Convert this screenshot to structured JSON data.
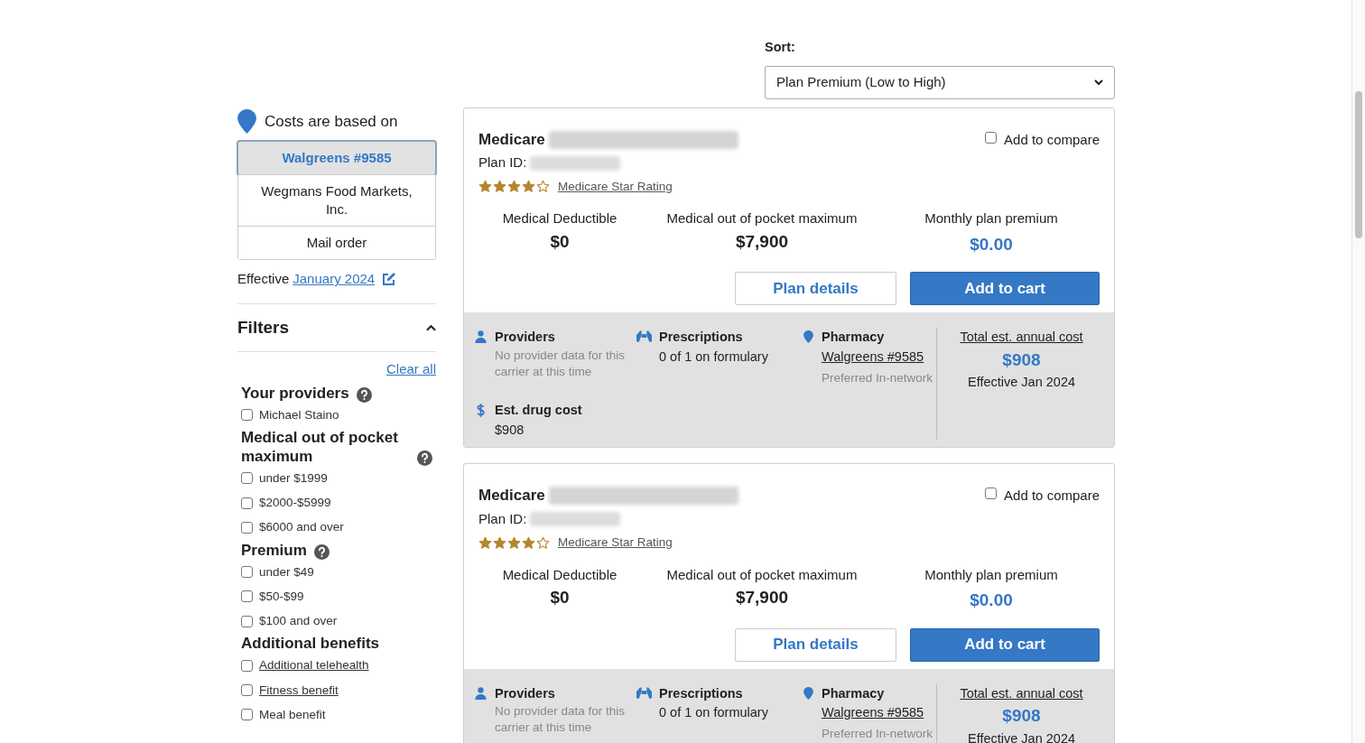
{
  "sort": {
    "label": "Sort:",
    "value": "Plan Premium (Low to High)"
  },
  "sidebar": {
    "costs_label": "Costs are based on",
    "pharmacies": [
      {
        "label": "Walgreens #9585",
        "selected": true
      },
      {
        "label": "Wegmans Food Markets, Inc.",
        "selected": false
      },
      {
        "label": "Mail order",
        "selected": false
      }
    ],
    "effective_label": "Effective",
    "effective_link": "January 2024",
    "filters": {
      "title": "Filters",
      "expanded": true,
      "clear_all": "Clear all",
      "groups": [
        {
          "title": "Your providers",
          "help": true,
          "options": [
            {
              "label": "Michael Staino",
              "checked": false,
              "link": false
            }
          ]
        },
        {
          "title": "Medical out of pocket maximum",
          "help": true,
          "options": [
            {
              "label": "under $1999",
              "checked": false,
              "link": false
            },
            {
              "label": "$2000-$5999",
              "checked": false,
              "link": false
            },
            {
              "label": "$6000 and over",
              "checked": false,
              "link": false
            }
          ]
        },
        {
          "title": "Premium",
          "help": true,
          "options": [
            {
              "label": "under $49",
              "checked": false,
              "link": false
            },
            {
              "label": "$50-$99",
              "checked": false,
              "link": false
            },
            {
              "label": "$100 and over",
              "checked": false,
              "link": false
            }
          ]
        },
        {
          "title": "Additional benefits",
          "help": false,
          "options": [
            {
              "label": "Additional telehealth",
              "checked": false,
              "link": true
            },
            {
              "label": "Fitness benefit",
              "checked": false,
              "link": true
            },
            {
              "label": "Meal benefit",
              "checked": false,
              "link": false
            }
          ]
        }
      ]
    }
  },
  "plans": [
    {
      "name": "Medicare",
      "plan_id_label": "Plan ID:",
      "stars": 4,
      "rating_link": "Medicare Star Rating",
      "compare": {
        "label": "Add to compare",
        "checked": false
      },
      "stats": [
        {
          "label": "Medical Deductible",
          "value": "$0",
          "kind": "plain"
        },
        {
          "label": "Medical out of pocket maximum",
          "value": "$7,900",
          "kind": "plain"
        },
        {
          "label": "Monthly plan premium",
          "value": "$0.00",
          "kind": "highlight"
        }
      ],
      "details_button": "Plan details",
      "cart_button": "Add to cart",
      "providers": {
        "title": "Providers",
        "text": "No provider data for this carrier at this time"
      },
      "prescriptions": {
        "title": "Prescriptions",
        "text": "0 of 1 on formulary"
      },
      "pharmacy": {
        "title": "Pharmacy",
        "link": "Walgreens #9585",
        "status": "Preferred In-network"
      },
      "drug_cost": {
        "title": "Est. drug cost",
        "value": "$908"
      },
      "total": {
        "label": "Total est. annual cost",
        "value": "$908",
        "effective": "Effective Jan 2024"
      }
    },
    {
      "name": "Medicare",
      "plan_id_label": "Plan ID:",
      "stars": 4,
      "rating_link": "Medicare Star Rating",
      "compare": {
        "label": "Add to compare",
        "checked": false
      },
      "stats": [
        {
          "label": "Medical Deductible",
          "value": "$0",
          "kind": "plain"
        },
        {
          "label": "Medical out of pocket maximum",
          "value": "$7,900",
          "kind": "plain"
        },
        {
          "label": "Monthly plan premium",
          "value": "$0.00",
          "kind": "highlight"
        }
      ],
      "details_button": "Plan details",
      "cart_button": "Add to cart",
      "providers": {
        "title": "Providers",
        "text": "No provider data for this carrier at this time"
      },
      "prescriptions": {
        "title": "Prescriptions",
        "text": "0 of 1 on formulary"
      },
      "pharmacy": {
        "title": "Pharmacy",
        "link": "Walgreens #9585",
        "status": "Preferred In-network"
      },
      "total": {
        "label": "Total est. annual cost",
        "value": "$908",
        "effective": "Effective Jan 2024"
      }
    }
  ]
}
